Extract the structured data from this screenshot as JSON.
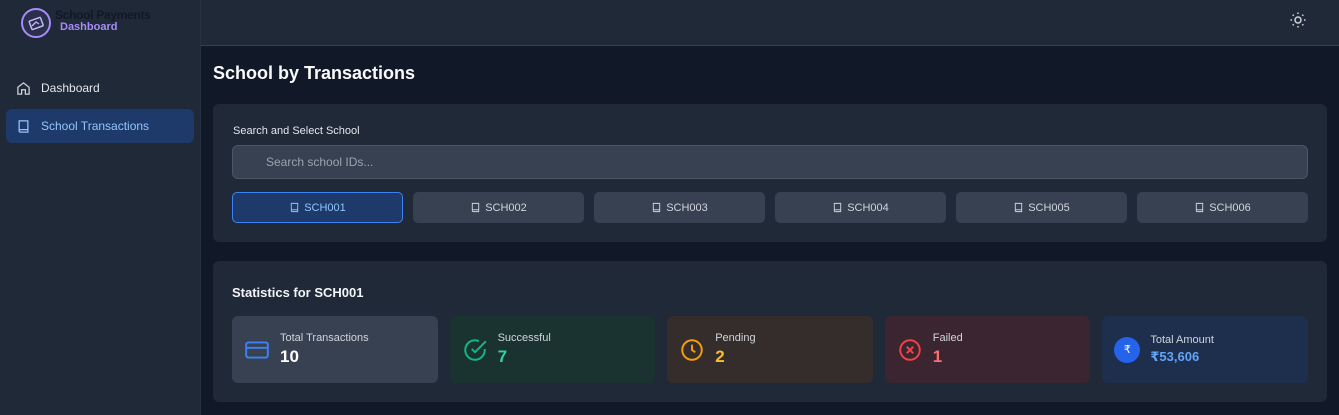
{
  "brand": {
    "title": "School Payments",
    "subtitle": "Dashboard"
  },
  "nav": [
    {
      "label": "Dashboard",
      "icon": "home-icon",
      "active": false
    },
    {
      "label": "School Transactions",
      "icon": "book-icon",
      "active": true
    }
  ],
  "page": {
    "title": "School by Transactions"
  },
  "search": {
    "label": "Search and Select School",
    "placeholder": "Search school IDs..."
  },
  "schools": [
    "SCH001",
    "SCH002",
    "SCH003",
    "SCH004",
    "SCH005",
    "SCH006"
  ],
  "selected_school": "SCH001",
  "stats": {
    "title": "Statistics for SCH001",
    "total": {
      "label": "Total Transactions",
      "value": "10"
    },
    "successful": {
      "label": "Successful",
      "value": "7"
    },
    "pending": {
      "label": "Pending",
      "value": "2"
    },
    "failed": {
      "label": "Failed",
      "value": "1"
    },
    "amount": {
      "label": "Total Amount",
      "value": "₹53,606",
      "symbol": "₹"
    }
  },
  "colors": {
    "accent": "#3b82f6",
    "success": "#34d399",
    "pending": "#fbbf24",
    "failed": "#f87171",
    "brand": "#a78bfa"
  }
}
